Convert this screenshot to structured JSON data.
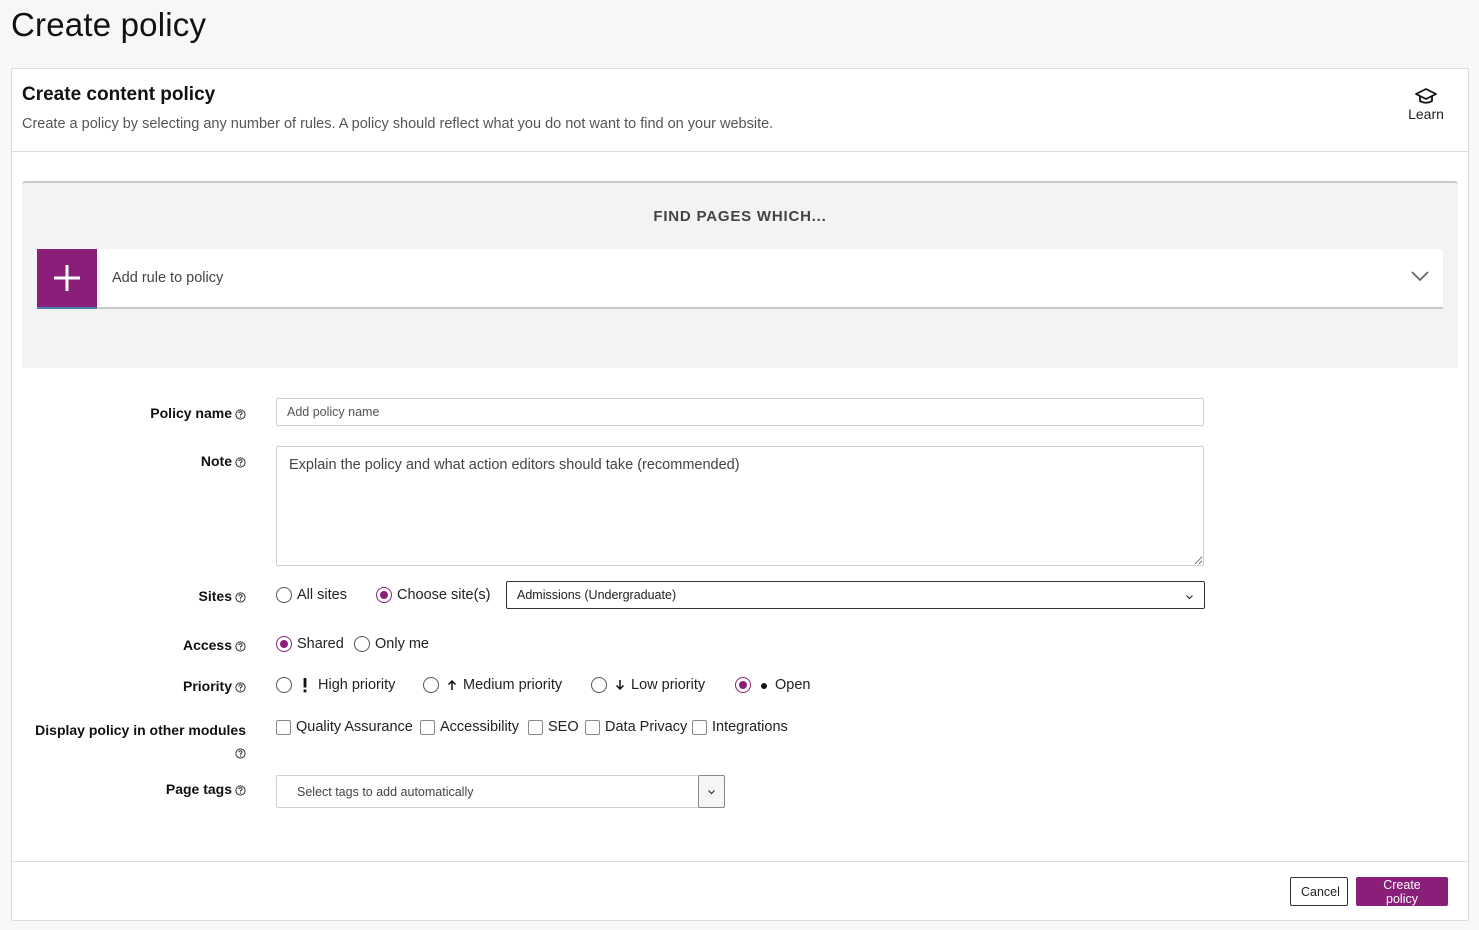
{
  "page": {
    "title": "Create policy"
  },
  "card": {
    "title": "Create content policy",
    "subtitle": "Create a policy by selecting any number of rules. A policy should reflect what you do not want to find on your website.",
    "learn_label": "Learn",
    "learn_icon": "graduation-cap-icon"
  },
  "rules": {
    "heading": "FIND PAGES WHICH...",
    "add_rule_label": "Add rule to policy",
    "accent_color": "#8a1f7a"
  },
  "form": {
    "policy_name": {
      "label": "Policy name",
      "placeholder": "Add policy name",
      "value": ""
    },
    "note": {
      "label": "Note",
      "placeholder": "Explain the policy and what action editors should take (recommended)",
      "value": ""
    },
    "sites": {
      "label": "Sites",
      "options": [
        {
          "label": "All sites",
          "checked": false
        },
        {
          "label": "Choose site(s)",
          "checked": true
        }
      ],
      "selected_site": "Admissions (Undergraduate)"
    },
    "access": {
      "label": "Access",
      "options": [
        {
          "label": "Shared",
          "checked": true
        },
        {
          "label": "Only me",
          "checked": false
        }
      ]
    },
    "priority": {
      "label": "Priority",
      "options": [
        {
          "label": "High priority",
          "icon": "exclamation-icon",
          "checked": false
        },
        {
          "label": "Medium priority",
          "icon": "arrow-up-icon",
          "checked": false
        },
        {
          "label": "Low priority",
          "icon": "arrow-down-icon",
          "checked": false
        },
        {
          "label": "Open",
          "icon": "dot-icon",
          "checked": true
        }
      ]
    },
    "modules": {
      "label": "Display policy in other modules",
      "options": [
        {
          "label": "Quality Assurance",
          "checked": false
        },
        {
          "label": "Accessibility",
          "checked": false
        },
        {
          "label": "SEO",
          "checked": false
        },
        {
          "label": "Data Privacy",
          "checked": false
        },
        {
          "label": "Integrations",
          "checked": false
        }
      ]
    },
    "page_tags": {
      "label": "Page tags",
      "placeholder": "Select tags to add automatically"
    }
  },
  "footer": {
    "cancel_label": "Cancel",
    "create_label": "Create policy"
  }
}
